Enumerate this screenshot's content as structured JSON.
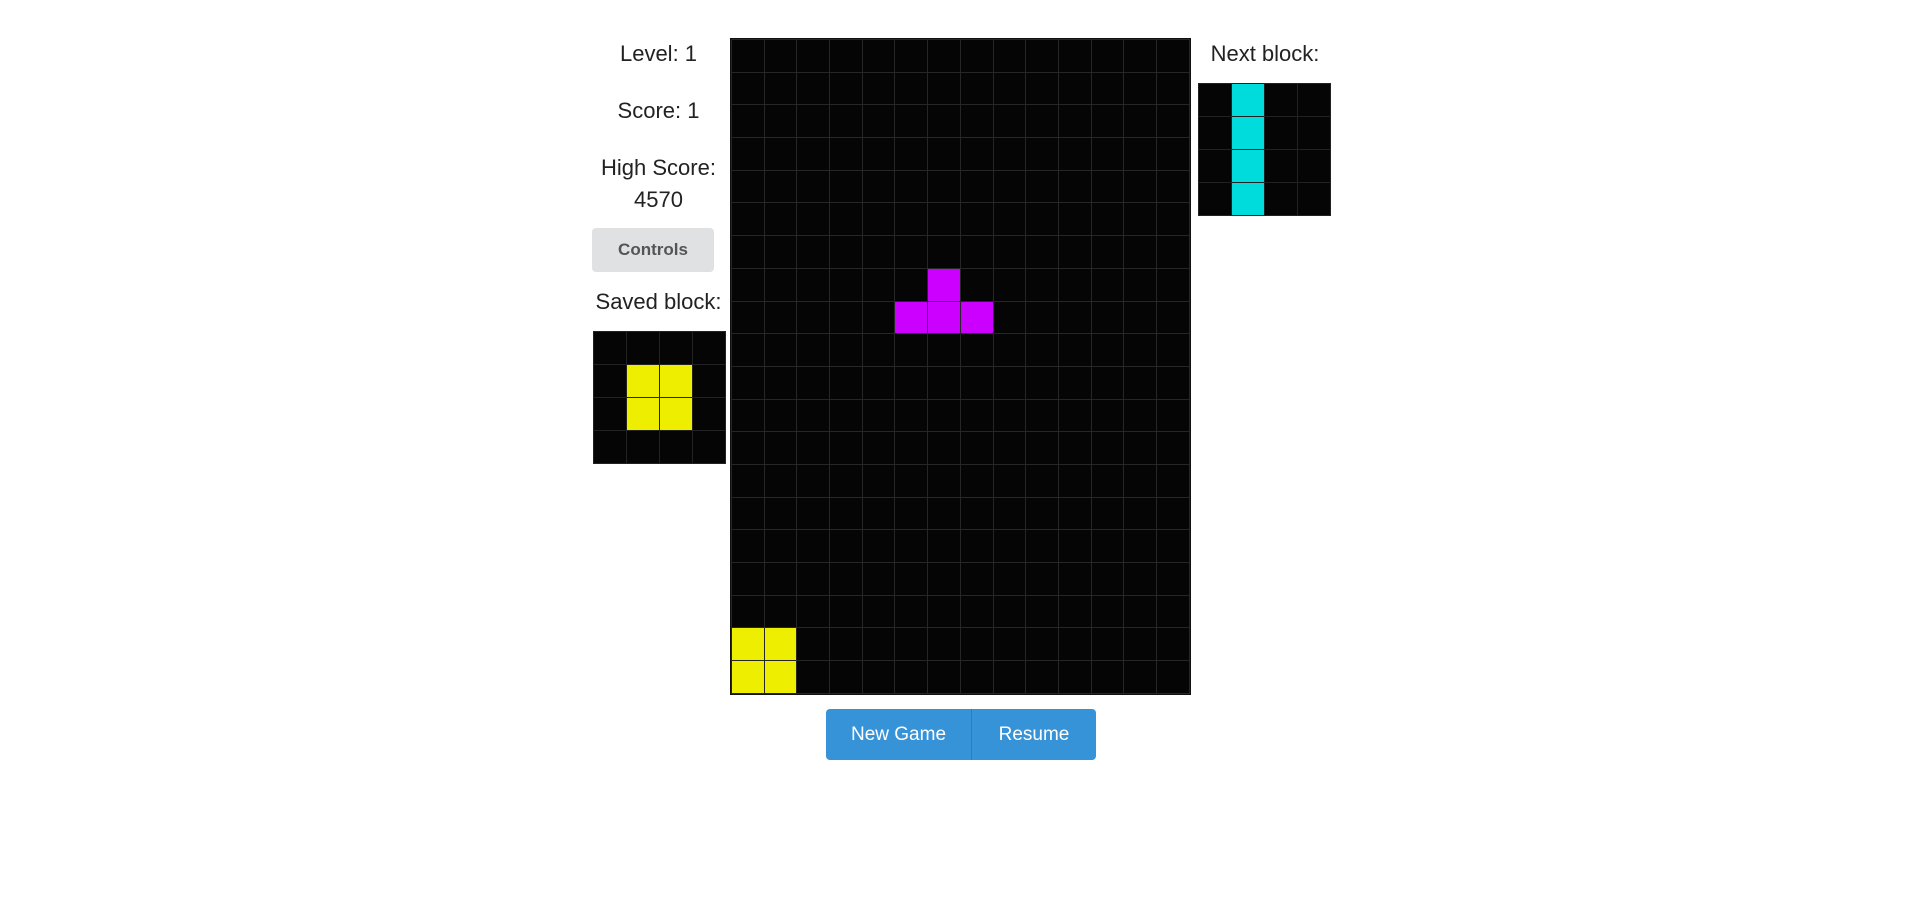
{
  "stats": {
    "level_label": "Level: 1",
    "score_label": "Score: 1",
    "high_score_label": "High Score:",
    "high_score_value": "4570"
  },
  "controls_label": "Controls",
  "saved_label": "Saved block:",
  "next_label": "Next block:",
  "buttons": {
    "new_game": "New Game",
    "resume": "Resume"
  },
  "colors": {
    "empty": "#050505",
    "yellow": "#eeee00",
    "purple": "#cc00ff",
    "cyan": "#00dcdc"
  },
  "board": {
    "cols": 14,
    "rows": 20,
    "filled": [
      {
        "r": 7,
        "c": 6,
        "color": "purple"
      },
      {
        "r": 8,
        "c": 5,
        "color": "purple"
      },
      {
        "r": 8,
        "c": 6,
        "color": "purple"
      },
      {
        "r": 8,
        "c": 7,
        "color": "purple"
      },
      {
        "r": 18,
        "c": 0,
        "color": "yellow"
      },
      {
        "r": 18,
        "c": 1,
        "color": "yellow"
      },
      {
        "r": 19,
        "c": 0,
        "color": "yellow"
      },
      {
        "r": 19,
        "c": 1,
        "color": "yellow"
      }
    ]
  },
  "saved_block": {
    "filled": [
      {
        "r": 1,
        "c": 1,
        "color": "yellow"
      },
      {
        "r": 1,
        "c": 2,
        "color": "yellow"
      },
      {
        "r": 2,
        "c": 1,
        "color": "yellow"
      },
      {
        "r": 2,
        "c": 2,
        "color": "yellow"
      }
    ]
  },
  "next_block": {
    "filled": [
      {
        "r": 0,
        "c": 1,
        "color": "cyan"
      },
      {
        "r": 1,
        "c": 1,
        "color": "cyan"
      },
      {
        "r": 2,
        "c": 1,
        "color": "cyan"
      },
      {
        "r": 3,
        "c": 1,
        "color": "cyan"
      }
    ]
  }
}
